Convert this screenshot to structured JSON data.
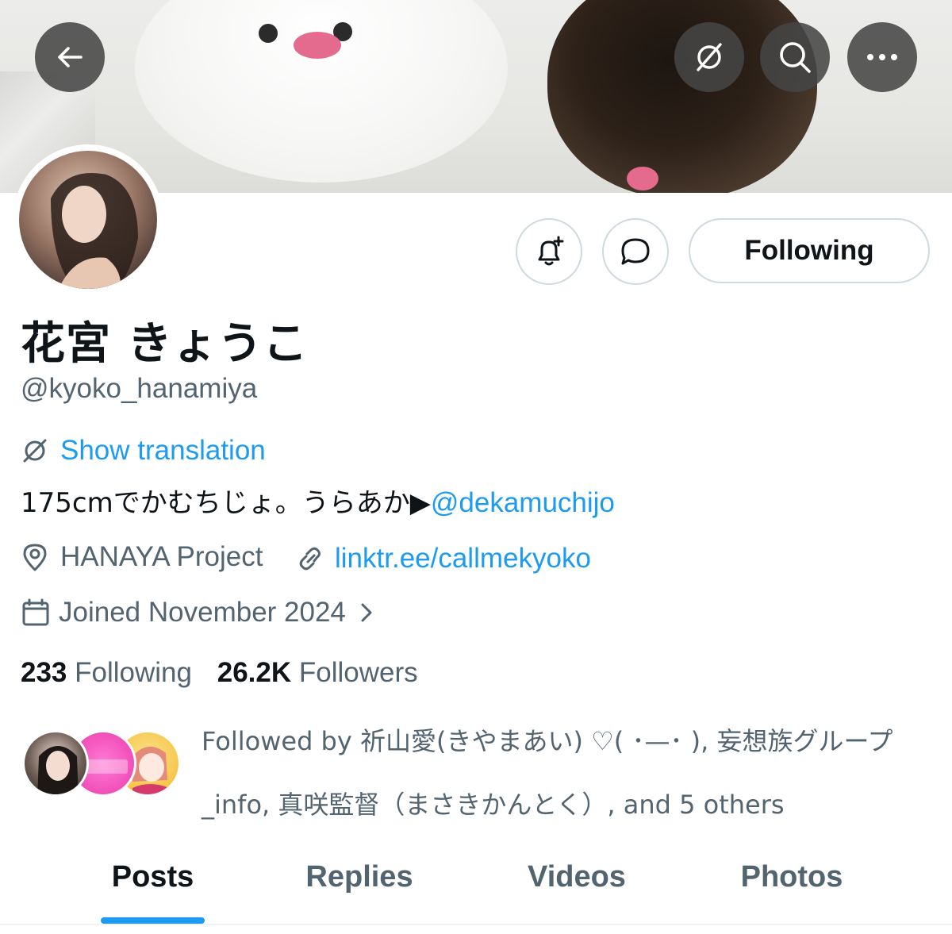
{
  "header": {
    "back_label": "Back",
    "translate_label": "Translate",
    "search_label": "Search",
    "more_label": "More"
  },
  "profile": {
    "display_name": "花宮 きょうこ",
    "handle": "@kyoko_hanamiya",
    "show_translation": "Show translation",
    "bio_text": "175cmでかむちじょ。うらあか▶",
    "bio_mention": "@dekamuchijo",
    "location": "HANAYA Project",
    "link": "linktr.ee/callmekyoko",
    "joined": "Joined November 2024",
    "following_count": "233",
    "following_label": "Following",
    "followers_count": "26.2K",
    "followers_label": "Followers",
    "followed_by": "Followed by 祈山愛(きやまあい) ♡( ･—･ ), 妄想族グループ_info, 真咲監督（まさきかんとく）, and 5 others"
  },
  "actions": {
    "following_button": "Following"
  },
  "tabs": [
    {
      "label": "Posts",
      "active": true
    },
    {
      "label": "Replies",
      "active": false
    },
    {
      "label": "Videos",
      "active": false
    },
    {
      "label": "Photos",
      "active": false
    }
  ],
  "colors": {
    "accent": "#1d9bf0",
    "text_primary": "#0f1419",
    "text_secondary": "#536471",
    "border": "#cfd9de"
  },
  "icons": [
    "arrow-left-icon",
    "translate-icon",
    "search-icon",
    "more-icon",
    "bell-plus-icon",
    "message-icon",
    "location-icon",
    "link-icon",
    "calendar-icon",
    "chevron-right-icon"
  ]
}
